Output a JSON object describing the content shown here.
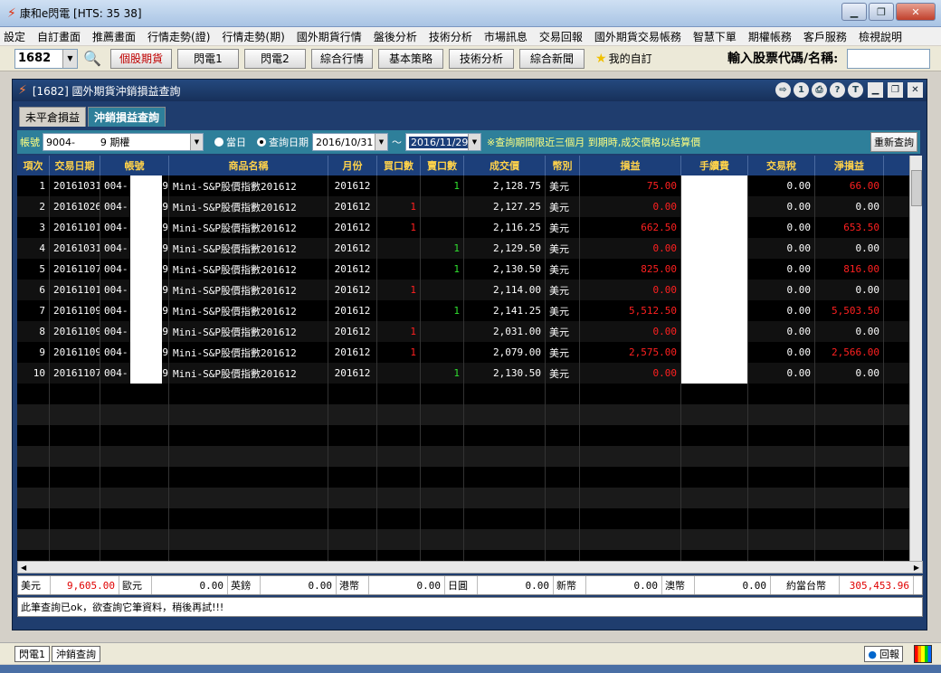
{
  "window": {
    "title": "康和e閃電 [HTS: 35 38]"
  },
  "menu": [
    "設定",
    "自訂畫面",
    "推薦畫面",
    "行情走勢(證)",
    "行情走勢(期)",
    "國外期貨行情",
    "盤後分析",
    "技術分析",
    "市場訊息",
    "交易回報",
    "國外期貨交易帳務",
    "智慧下單",
    "期權帳務",
    "客戶服務",
    "檢視說明"
  ],
  "toolbar": {
    "code": "1682",
    "buttons": [
      "個股期貨",
      "閃電1",
      "閃電2",
      "綜合行情",
      "基本策略",
      "技術分析",
      "綜合新聞"
    ],
    "favorites": "我的自訂",
    "input_label": "輸入股票代碼/名稱:"
  },
  "panel": {
    "title": "[1682] 國外期貨沖銷損益查詢",
    "tabs": [
      "未平倉損益",
      "沖銷損益查詢"
    ],
    "filter": {
      "account_label": "帳號",
      "account_value": "9004-        9 期權",
      "radio_today": "當日",
      "radio_date": "查詢日期",
      "date_from": "2016/10/31",
      "date_to": "2016/11/29",
      "tilde": "～",
      "note": "※查詢期間限近三個月 到期時,成交價格以結算價",
      "refresh": "重新查詢"
    },
    "headers": [
      "項次",
      "交易日期",
      "帳號",
      "商品名稱",
      "月份",
      "買口數",
      "賣口數",
      "成交價",
      "幣別",
      "損益",
      "手續費",
      "交易稅",
      "淨損益"
    ],
    "rows": [
      {
        "no": "1",
        "date": "20161031",
        "acct_a": "004-",
        "acct_b": "9",
        "product": "Mini-S&P股價指數201612",
        "month": "201612",
        "buy": "",
        "sell": "1",
        "price": "2,128.75",
        "cur": "美元",
        "pl": "75.00",
        "fee": "",
        "tax": "0.00",
        "net": "66.00"
      },
      {
        "no": "2",
        "date": "20161026",
        "acct_a": "004-",
        "acct_b": "9",
        "product": "Mini-S&P股價指數201612",
        "month": "201612",
        "buy": "1",
        "sell": "",
        "price": "2,127.25",
        "cur": "美元",
        "pl": "0.00",
        "fee": "",
        "tax": "0.00",
        "net": "0.00"
      },
      {
        "no": "3",
        "date": "20161101",
        "acct_a": "004-",
        "acct_b": "9",
        "product": "Mini-S&P股價指數201612",
        "month": "201612",
        "buy": "1",
        "sell": "",
        "price": "2,116.25",
        "cur": "美元",
        "pl": "662.50",
        "fee": "",
        "tax": "0.00",
        "net": "653.50"
      },
      {
        "no": "4",
        "date": "20161031",
        "acct_a": "004-",
        "acct_b": "9",
        "product": "Mini-S&P股價指數201612",
        "month": "201612",
        "buy": "",
        "sell": "1",
        "price": "2,129.50",
        "cur": "美元",
        "pl": "0.00",
        "fee": "",
        "tax": "0.00",
        "net": "0.00"
      },
      {
        "no": "5",
        "date": "20161107",
        "acct_a": "004-",
        "acct_b": "9",
        "product": "Mini-S&P股價指數201612",
        "month": "201612",
        "buy": "",
        "sell": "1",
        "price": "2,130.50",
        "cur": "美元",
        "pl": "825.00",
        "fee": "",
        "tax": "0.00",
        "net": "816.00"
      },
      {
        "no": "6",
        "date": "20161101",
        "acct_a": "004-",
        "acct_b": "9",
        "product": "Mini-S&P股價指數201612",
        "month": "201612",
        "buy": "1",
        "sell": "",
        "price": "2,114.00",
        "cur": "美元",
        "pl": "0.00",
        "fee": "",
        "tax": "0.00",
        "net": "0.00"
      },
      {
        "no": "7",
        "date": "20161109",
        "acct_a": "004-",
        "acct_b": "9",
        "product": "Mini-S&P股價指數201612",
        "month": "201612",
        "buy": "",
        "sell": "1",
        "price": "2,141.25",
        "cur": "美元",
        "pl": "5,512.50",
        "fee": "",
        "tax": "0.00",
        "net": "5,503.50"
      },
      {
        "no": "8",
        "date": "20161109",
        "acct_a": "004-",
        "acct_b": "9",
        "product": "Mini-S&P股價指數201612",
        "month": "201612",
        "buy": "1",
        "sell": "",
        "price": "2,031.00",
        "cur": "美元",
        "pl": "0.00",
        "fee": "",
        "tax": "0.00",
        "net": "0.00"
      },
      {
        "no": "9",
        "date": "20161109",
        "acct_a": "004-",
        "acct_b": "9",
        "product": "Mini-S&P股價指數201612",
        "month": "201612",
        "buy": "1",
        "sell": "",
        "price": "2,079.00",
        "cur": "美元",
        "pl": "2,575.00",
        "fee": "",
        "tax": "0.00",
        "net": "2,566.00"
      },
      {
        "no": "10",
        "date": "20161107",
        "acct_a": "004-",
        "acct_b": "9",
        "product": "Mini-S&P股價指數201612",
        "month": "201612",
        "buy": "",
        "sell": "1",
        "price": "2,130.50",
        "cur": "美元",
        "pl": "0.00",
        "fee": "",
        "tax": "0.00",
        "net": "0.00"
      }
    ],
    "totals": [
      {
        "label": "美元",
        "value": "9,605.00",
        "red": true
      },
      {
        "label": "歐元",
        "value": "0.00",
        "red": false
      },
      {
        "label": "英鎊",
        "value": "0.00",
        "red": false
      },
      {
        "label": "港幣",
        "value": "0.00",
        "red": false
      },
      {
        "label": "日圓",
        "value": "0.00",
        "red": false
      },
      {
        "label": "新幣",
        "value": "0.00",
        "red": false
      },
      {
        "label": "澳幣",
        "value": "0.00",
        "red": false
      },
      {
        "label": "約當台幣",
        "value": "305,453.96",
        "red": true
      }
    ],
    "status": "此筆查詢已ok，欲查詢它筆資料，稍後再試!!!"
  },
  "bottom": {
    "tabs": [
      "閃電1",
      "沖銷查詢"
    ],
    "report": "回報"
  },
  "colors": {
    "header_bg": "#1c3f7a",
    "header_text": "#ffd24a",
    "profit": "#ff2020",
    "sell": "#30e030",
    "panel": "#1f3d6e",
    "filter": "#2e7f9a"
  }
}
